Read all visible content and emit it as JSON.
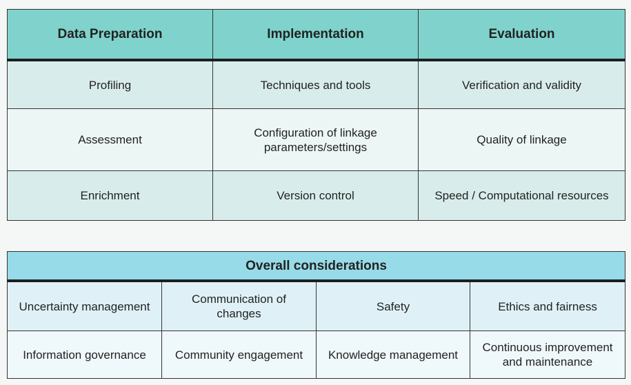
{
  "phases_table": {
    "headers": [
      "Data Preparation",
      "Implementation",
      "Evaluation"
    ],
    "rows": [
      [
        "Profiling",
        "Techniques and tools",
        "Verification and validity"
      ],
      [
        "Assessment",
        "Configuration of linkage parameters/settings",
        "Quality of linkage"
      ],
      [
        "Enrichment",
        "Version control",
        "Speed / Computational resources"
      ]
    ]
  },
  "overall_table": {
    "title": "Overall considerations",
    "rows": [
      [
        "Uncertainty management",
        "Communication of changes",
        "Safety",
        "Ethics and fairness"
      ],
      [
        "Information governance",
        "Community engagement",
        "Knowledge management",
        "Continuous improvement and maintenance"
      ]
    ]
  },
  "colors": {
    "phases_header": "#7fd3cc",
    "phases_row_dark": "#d8edeb",
    "phases_row_light": "#ecf6f5",
    "overall_header": "#98dbe8",
    "overall_row_dark": "#dff1f6",
    "overall_row_light": "#eff8fb",
    "border": "#333333"
  }
}
